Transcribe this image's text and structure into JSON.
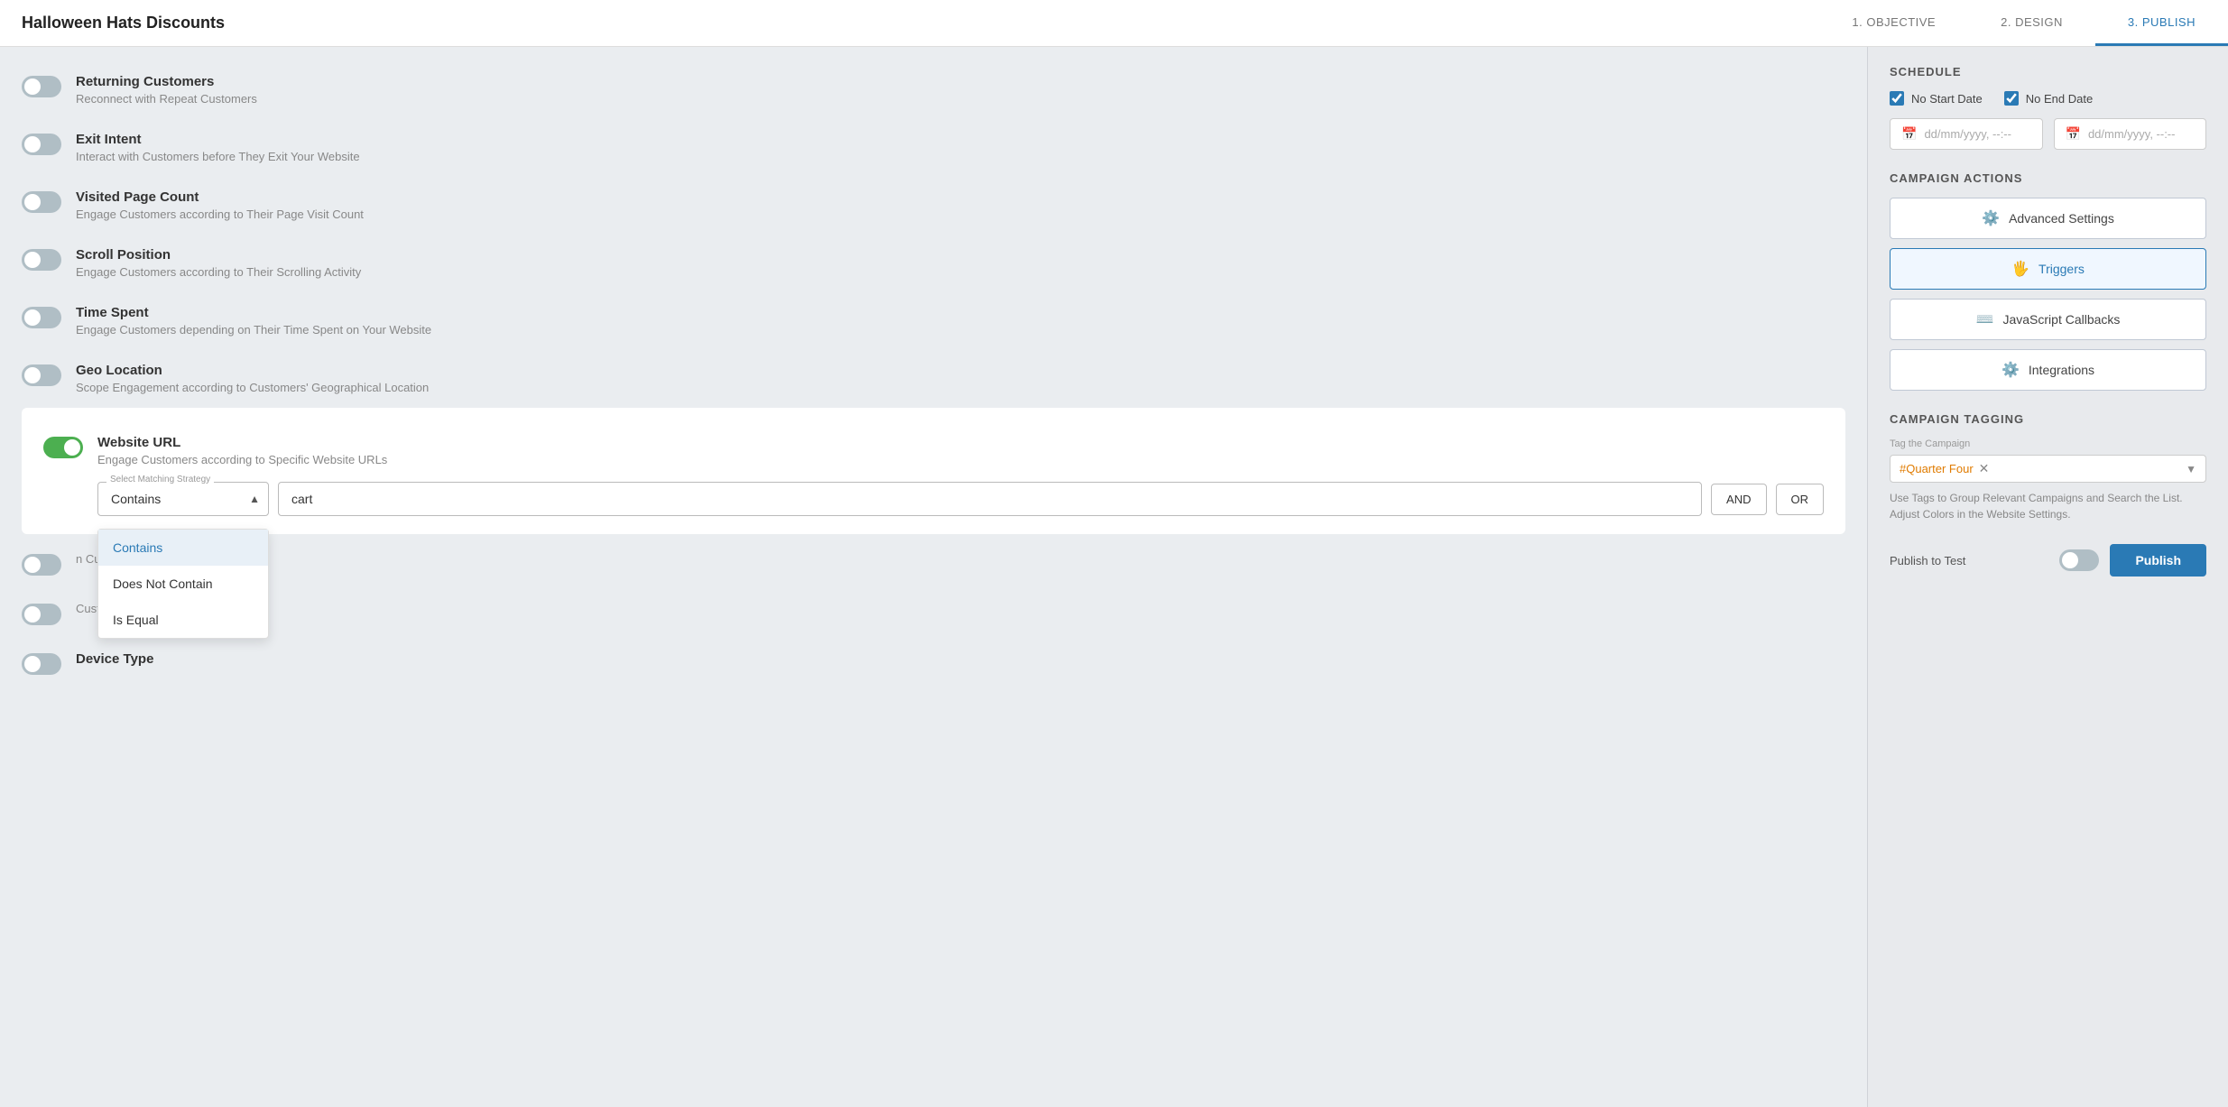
{
  "app": {
    "campaign_title": "Halloween Hats Discounts"
  },
  "nav": {
    "tabs": [
      {
        "id": "objective",
        "label": "1. OBJECTIVE",
        "active": false
      },
      {
        "id": "design",
        "label": "2. DESIGN",
        "active": false
      },
      {
        "id": "publish",
        "label": "3. PUBLISH",
        "active": true
      }
    ]
  },
  "triggers": [
    {
      "id": "returning-customers",
      "label": "Returning Customers",
      "description": "Reconnect with Repeat Customers",
      "enabled": false
    },
    {
      "id": "exit-intent",
      "label": "Exit Intent",
      "description": "Interact with Customers before They Exit Your Website",
      "enabled": false
    },
    {
      "id": "visited-page-count",
      "label": "Visited Page Count",
      "description": "Engage Customers according to Their Page Visit Count",
      "enabled": false
    },
    {
      "id": "scroll-position",
      "label": "Scroll Position",
      "description": "Engage Customers according to Their Scrolling Activity",
      "enabled": false
    },
    {
      "id": "time-spent",
      "label": "Time Spent",
      "description": "Engage Customers depending on Their Time Spent on Your Website",
      "enabled": false
    },
    {
      "id": "geo-location",
      "label": "Geo Location",
      "description": "Scope Engagement according to Customers' Geographical Location",
      "enabled": false
    },
    {
      "id": "website-url",
      "label": "Website URL",
      "description": "Engage Customers according to Specific Website URLs",
      "enabled": true,
      "expanded": true
    },
    {
      "id": "device-type",
      "label": "Device Type",
      "description": "",
      "enabled": false
    }
  ],
  "website_url": {
    "strategy_label": "Select Matching Strategy",
    "strategy_value": "Contains",
    "value_placeholder": "cart",
    "value_input": "cart",
    "and_label": "AND",
    "or_label": "OR",
    "dropdown_options": [
      {
        "value": "Contains",
        "label": "Contains",
        "selected": true
      },
      {
        "value": "Does Not Contain",
        "label": "Does Not Contain",
        "selected": false
      },
      {
        "value": "Is Equal",
        "label": "Is Equal",
        "selected": false
      }
    ]
  },
  "right_panel": {
    "schedule": {
      "title": "SCHEDULE",
      "no_start_date_label": "No Start Date",
      "no_end_date_label": "No End Date",
      "start_date_placeholder": "dd/mm/yyyy, --:--",
      "end_date_placeholder": "dd/mm/yyyy, --:--"
    },
    "campaign_actions": {
      "title": "CAMPAIGN ACTIONS",
      "buttons": [
        {
          "id": "advanced-settings",
          "label": "Advanced Settings",
          "icon": "⚙"
        },
        {
          "id": "triggers",
          "label": "Triggers",
          "icon": "🖐",
          "active": true
        },
        {
          "id": "javascript-callbacks",
          "label": "JavaScript Callbacks",
          "icon": "⌨"
        },
        {
          "id": "integrations",
          "label": "Integrations",
          "icon": "⚙"
        }
      ]
    },
    "campaign_tagging": {
      "title": "CAMPAIGN TAGGING",
      "label": "Tag the Campaign",
      "tag": "#Quarter Four",
      "hint": "Use Tags to Group Relevant Campaigns and Search the List. Adjust Colors in the Website Settings."
    },
    "publish": {
      "publish_to_test_label": "Publish to Test",
      "publish_btn_label": "Publish"
    }
  }
}
